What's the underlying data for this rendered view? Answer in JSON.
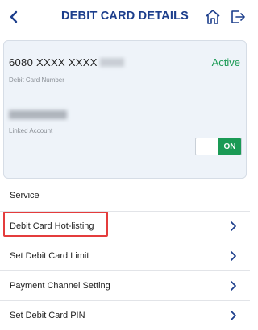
{
  "header": {
    "title": "DEBIT CARD DETAILS",
    "back_icon": "chevron-left-icon",
    "home_icon": "home-icon",
    "logout_icon": "logout-icon",
    "accent_color": "#1c3e8c"
  },
  "card": {
    "number_visible": "6080  XXXX  XXXX",
    "number_label": "Debit Card Number",
    "status": "Active",
    "linked_account_label": "Linked Account",
    "toggle_label": "ON",
    "status_color": "#1a9a55"
  },
  "services": {
    "section_title": "Service",
    "items": [
      {
        "label": "Debit Card Hot-listing",
        "highlighted": true
      },
      {
        "label": "Set Debit Card Limit"
      },
      {
        "label": "Payment Channel Setting"
      },
      {
        "label": "Set Debit Card PIN"
      }
    ]
  }
}
